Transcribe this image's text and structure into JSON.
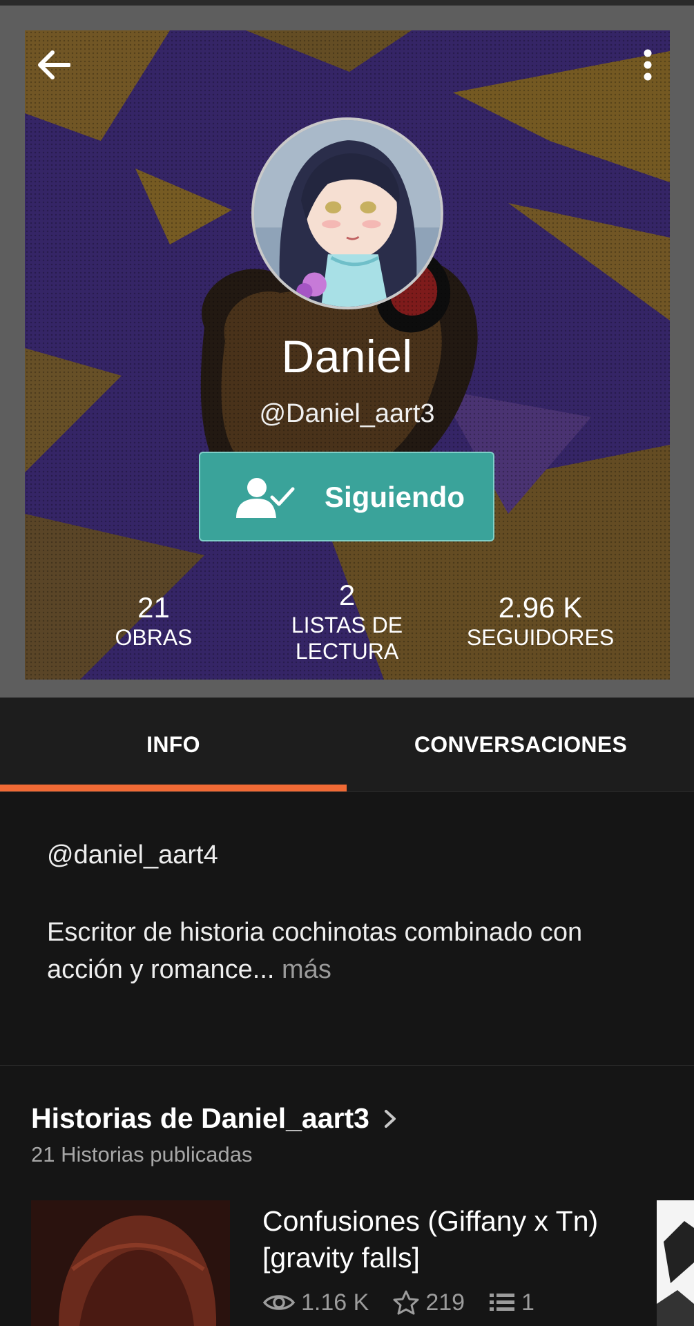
{
  "profile": {
    "name": "Daniel",
    "handle": "@Daniel_aart3",
    "follow_label": "Siguiendo",
    "stats": [
      {
        "value": "21",
        "label": "OBRAS"
      },
      {
        "value": "2",
        "label": "LISTAS DE LECTURA"
      },
      {
        "value": "2.96 K",
        "label": "SEGUIDORES"
      }
    ]
  },
  "tabs": [
    {
      "label": "INFO",
      "active": true
    },
    {
      "label": "CONVERSACIONES",
      "active": false
    }
  ],
  "about": {
    "line1": "@daniel_aart4",
    "bio": "Escritor de historia cochinotas combinado con acción y romance...",
    "more": " más"
  },
  "stories": {
    "title": "Historias de Daniel_aart3",
    "subtitle": "21 Historias publicadas",
    "items": [
      {
        "title": "Confusiones (Giffany x Tn) [gravity falls]",
        "reads": "1.16 K",
        "votes": "219",
        "parts": "1"
      }
    ]
  },
  "colors": {
    "accent": "#f06a35",
    "follow_button": "#3aa39a",
    "background": "#151515"
  },
  "icons": [
    "back-arrow-icon",
    "more-vert-icon",
    "user-check-icon",
    "chevron-right-icon",
    "eye-icon",
    "star-icon",
    "list-icon"
  ]
}
